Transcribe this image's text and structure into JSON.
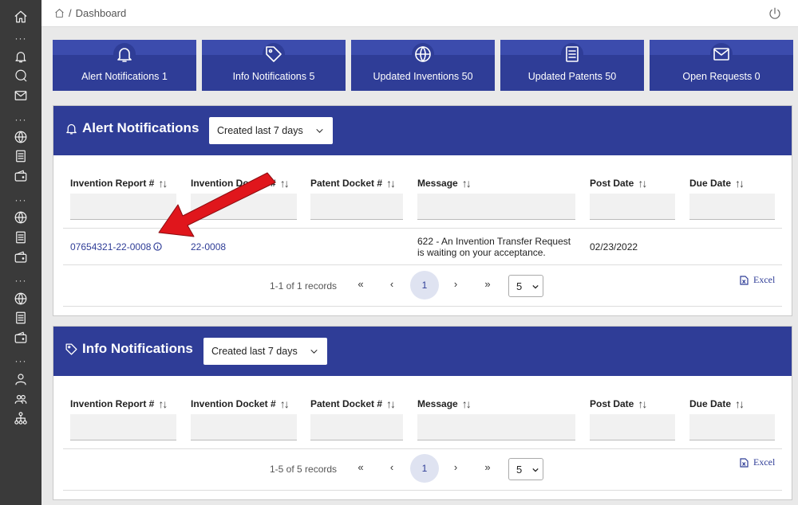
{
  "breadcrumb": {
    "separator": "/",
    "current": "Dashboard"
  },
  "tiles": [
    {
      "label": "Alert Notifications 1",
      "icon": "bell-icon"
    },
    {
      "label": "Info Notifications 5",
      "icon": "tag-icon"
    },
    {
      "label": "Updated Inventions 50",
      "icon": "globe-icon"
    },
    {
      "label": "Updated Patents 50",
      "icon": "document-icon"
    },
    {
      "label": "Open Requests 0",
      "icon": "envelope-icon"
    }
  ],
  "columns": [
    "Invention Report #",
    "Invention Docket #",
    "Patent Docket #",
    "Message",
    "Post Date",
    "Due Date"
  ],
  "sort_glyph": "↑↓",
  "alert_panel": {
    "title": "Alert Notifications",
    "filter_label": "Created last 7 days",
    "rows": [
      {
        "invention_report": "07654321-22-0008",
        "invention_docket": "22-0008",
        "patent_docket": "",
        "message_line1": "622 - An Invention Transfer Request",
        "message_line2": "is waiting on your acceptance.",
        "post_date": "02/23/2022",
        "due_date": ""
      }
    ],
    "records_text": "1-1 of 1 records",
    "page": "1",
    "page_size": "5",
    "excel_label": "Excel"
  },
  "info_panel": {
    "title": "Info Notifications",
    "filter_label": "Created last 7 days",
    "records_text": "1-5 of 5 records",
    "page": "1",
    "page_size": "5",
    "excel_label": "Excel"
  },
  "pager": {
    "first": "«",
    "prev": "‹",
    "next": "›",
    "last": "»"
  },
  "colors": {
    "primary": "#2f3d97",
    "rail": "#3a3a3a",
    "annotation": "#e0161c"
  }
}
